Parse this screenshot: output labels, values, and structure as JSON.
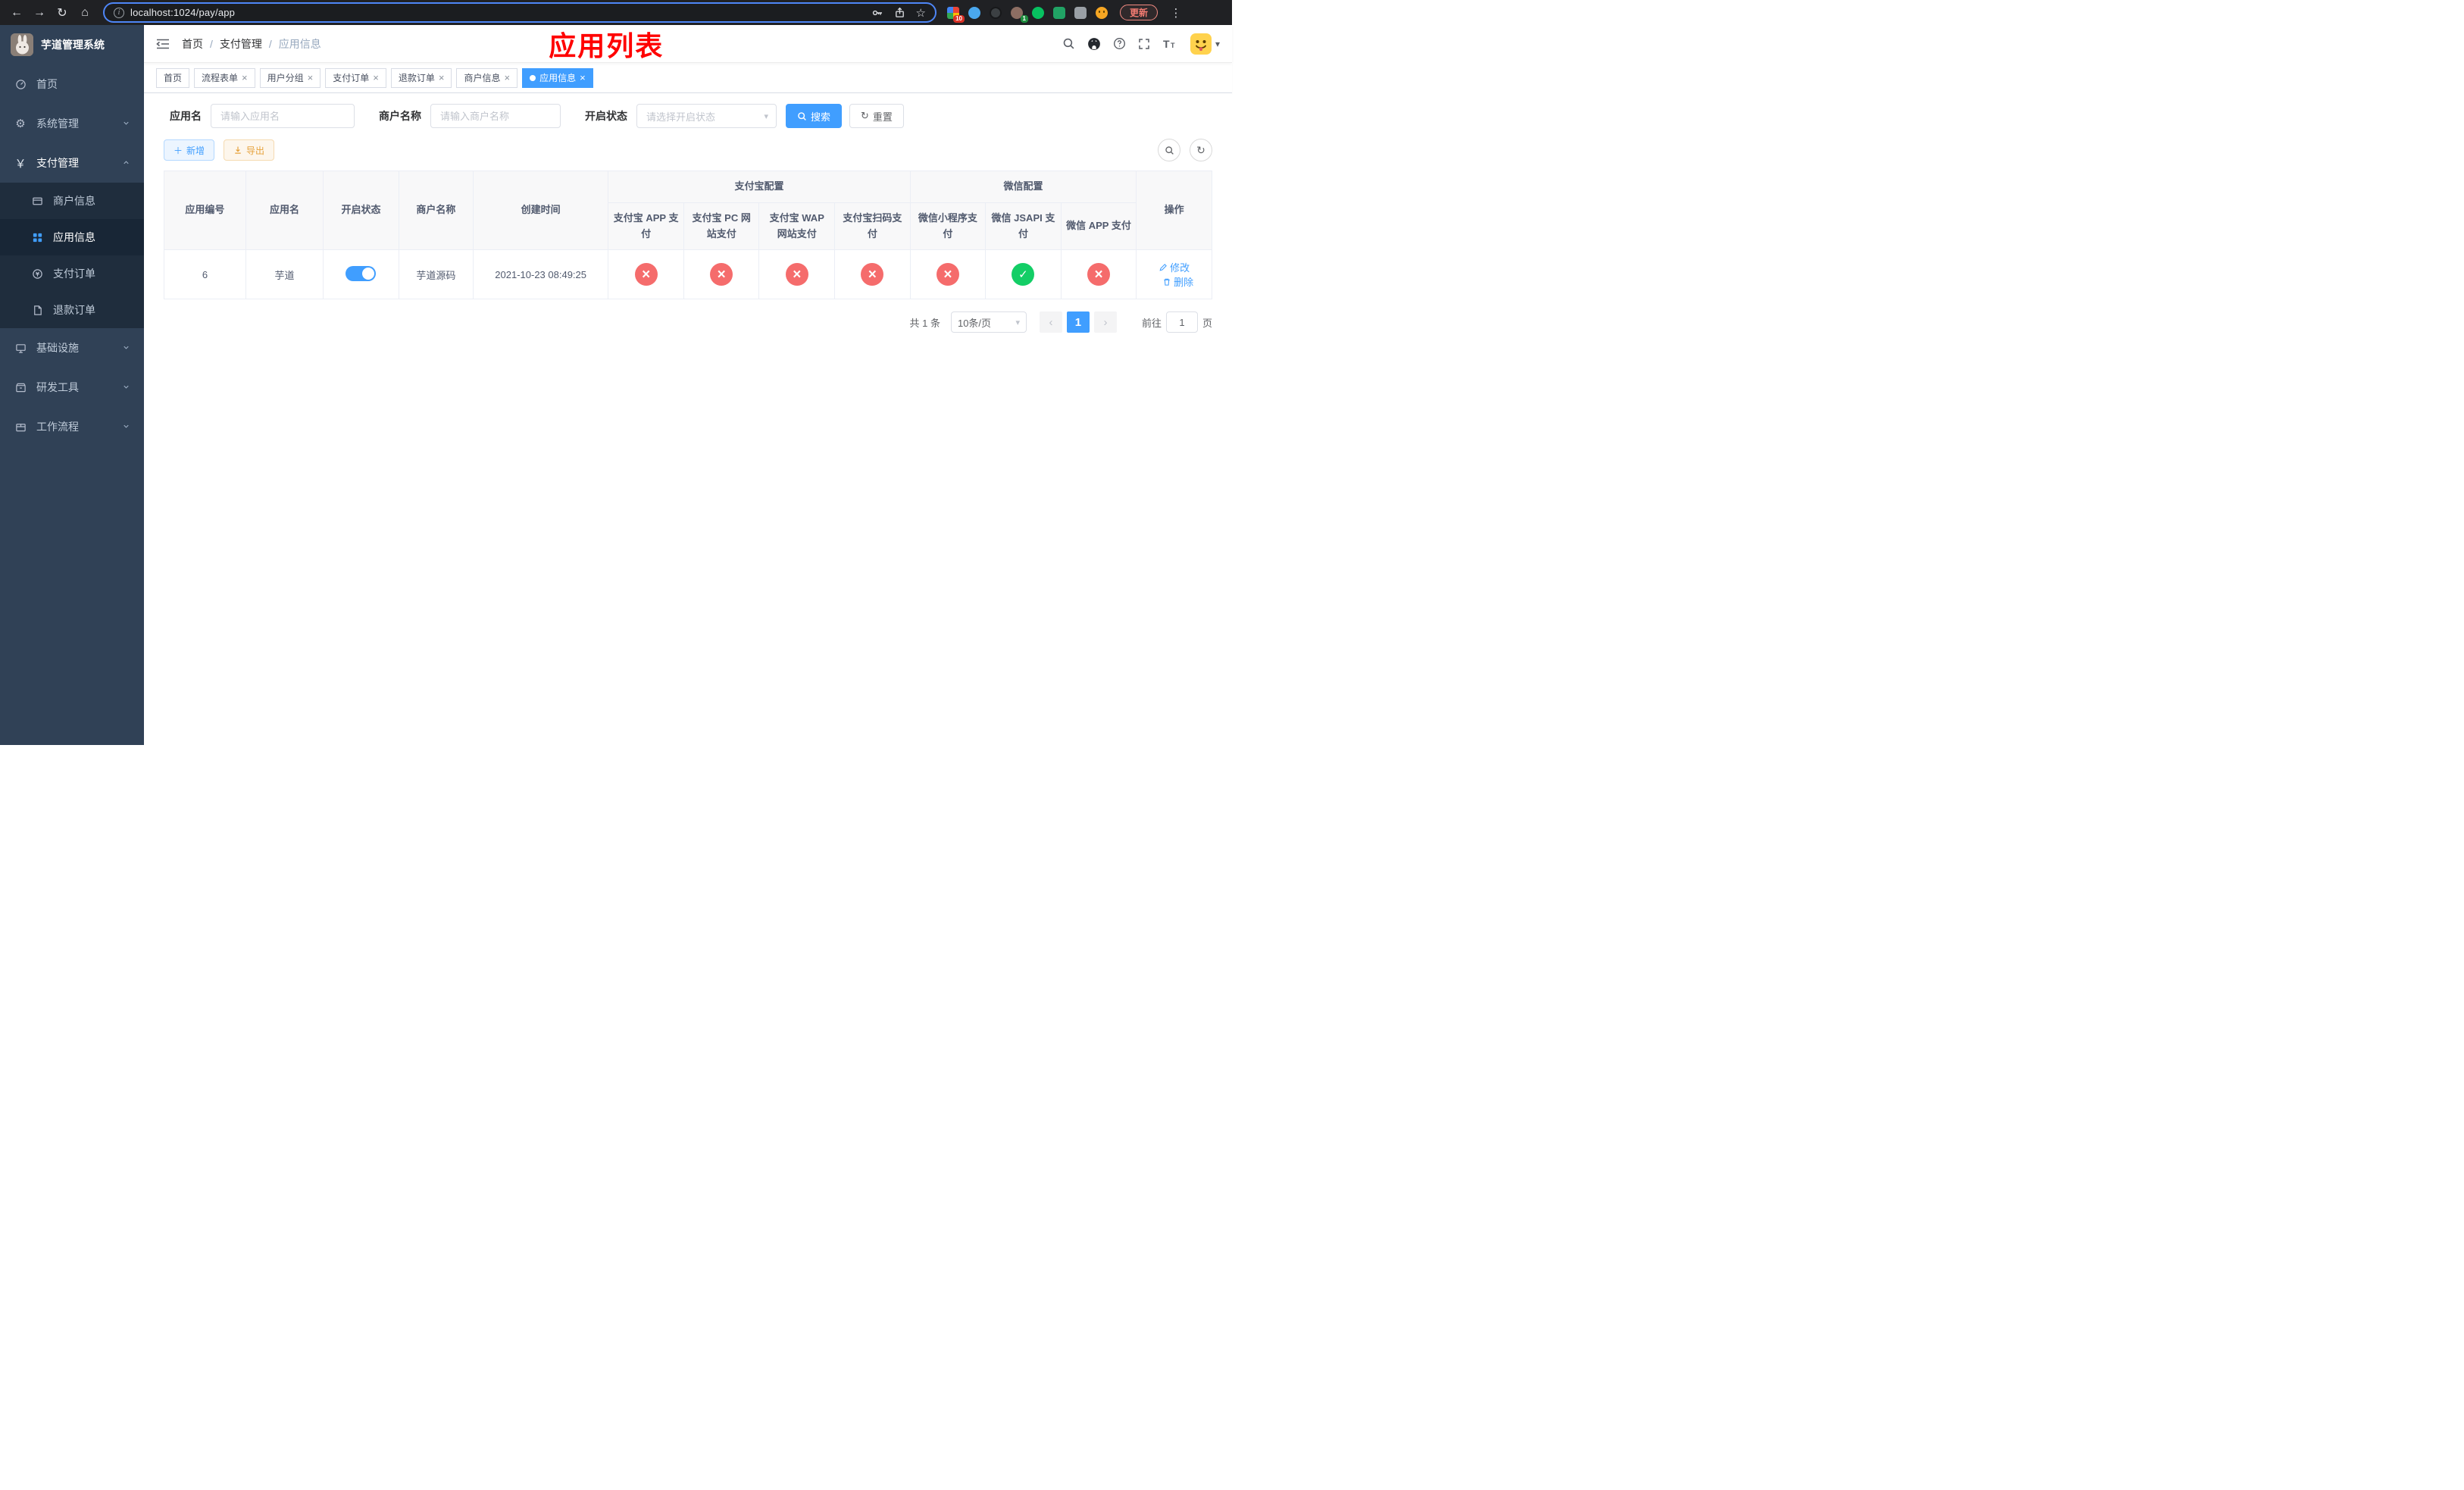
{
  "colors": {
    "accent": "#409EFF",
    "success": "#13ce66",
    "danger": "#f56c6c",
    "warning": "#e6a23c",
    "sidebar_bg": "#304156",
    "submenu_bg": "#1f2d3d",
    "annotation_red": "#ff0000"
  },
  "icons": {
    "back": "←",
    "forward": "→",
    "reload": "↻",
    "home": "⌂",
    "info": "i",
    "star": "☆",
    "menu_dots": "⋮",
    "gear": "⚙",
    "yen": "￥",
    "caret_down": "▾",
    "close": "×",
    "prev": "‹",
    "next": "›",
    "plus": "＋",
    "refresh": "↻"
  },
  "browser": {
    "url": "localhost:1024/pay/app",
    "update_label": "更新",
    "ext_badge_count": "10",
    "profile_badge_count": "1"
  },
  "sidebar": {
    "title": "芋道管理系统",
    "items": [
      {
        "label": "首页"
      },
      {
        "label": "系统管理"
      },
      {
        "label": "支付管理",
        "children": [
          {
            "label": "商户信息"
          },
          {
            "label": "应用信息",
            "active": true
          },
          {
            "label": "支付订单"
          },
          {
            "label": "退款订单"
          }
        ]
      },
      {
        "label": "基础设施"
      },
      {
        "label": "研发工具"
      },
      {
        "label": "工作流程"
      }
    ]
  },
  "navbar": {
    "breadcrumb": [
      "首页",
      "支付管理",
      "应用信息"
    ],
    "annotation": "应用列表"
  },
  "tabs": [
    {
      "label": "首页"
    },
    {
      "label": "流程表单"
    },
    {
      "label": "用户分组"
    },
    {
      "label": "支付订单"
    },
    {
      "label": "退款订单"
    },
    {
      "label": "商户信息"
    },
    {
      "label": "应用信息"
    }
  ],
  "filters": {
    "app_name_label": "应用名",
    "app_name_placeholder": "请输入应用名",
    "merchant_label": "商户名称",
    "merchant_placeholder": "请输入商户名称",
    "status_label": "开启状态",
    "status_placeholder": "请选择开启状态",
    "search_label": "搜索",
    "reset_label": "重置"
  },
  "toolbar": {
    "add_label": "新增",
    "export_label": "导出"
  },
  "table": {
    "groups": {
      "alipay": "支付宝配置",
      "wechat": "微信配置"
    },
    "columns": [
      "应用编号",
      "应用名",
      "开启状态",
      "商户名称",
      "创建时间",
      "支付宝 APP 支付",
      "支付宝 PC 网站支付",
      "支付宝 WAP 网站支付",
      "支付宝扫码支付",
      "微信小程序支付",
      "微信 JSAPI 支付",
      "微信 APP 支付",
      "操作"
    ],
    "rows": [
      {
        "app_id": "6",
        "app_name": "芋道",
        "enabled": "on",
        "merchant_name": "芋道源码",
        "created_at": "2021-10-23 08:49:25",
        "statuses": [
          "fail",
          "fail",
          "fail",
          "fail",
          "fail",
          "success",
          "fail"
        ],
        "edit_label": "修改",
        "delete_label": "删除"
      }
    ]
  },
  "pagination": {
    "total_label": "共 1 条",
    "page_size_label": "10条/页",
    "current_page": "1",
    "goto_label": "前往",
    "goto_value": "1",
    "goto_unit": "页"
  }
}
